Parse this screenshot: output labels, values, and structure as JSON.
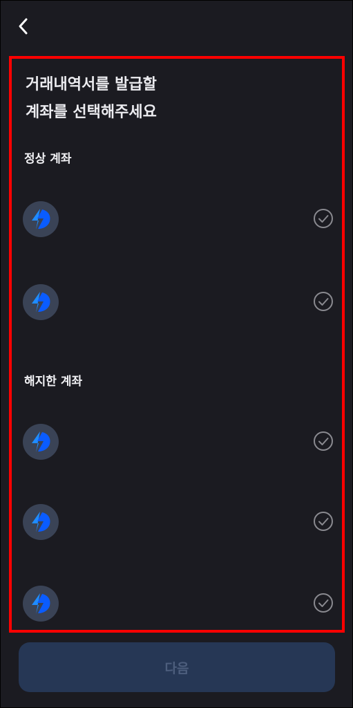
{
  "header": {
    "back_icon": "chevron-left-icon"
  },
  "title": {
    "line1": "거래내역서를 발급할",
    "line2": "계좌를 선택해주세요"
  },
  "sections": {
    "active_label": "정상 계좌",
    "closed_label": "해지한 계좌"
  },
  "accounts": {
    "active_count": 2,
    "closed_count": 3,
    "bank_icon": "bank-logo-icon",
    "check_icon": "check-circle-icon",
    "selected": false
  },
  "footer": {
    "next_label": "다음",
    "enabled": false
  },
  "colors": {
    "background": "#1b1b21",
    "highlight_border": "#ff0000",
    "button_bg": "#263755",
    "button_text": "#4d5e7d",
    "check_stroke": "#8a8a90"
  }
}
